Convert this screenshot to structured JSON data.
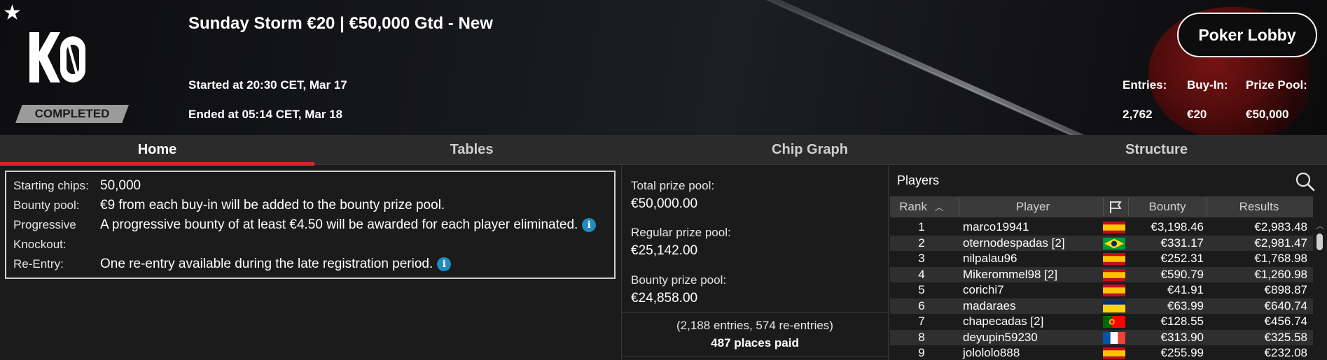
{
  "header": {
    "status_badge": "COMPLETED",
    "tournament_title": "Sunday Storm €20 | €50,000 Gtd - New",
    "started": "Started at 20:30 CET, Mar 17",
    "ended": "Ended at 05:14 CET, Mar 18",
    "lobby_button": "Poker Lobby",
    "logo_text": "KO",
    "stats": [
      {
        "label": "Entries:",
        "value": "2,762"
      },
      {
        "label": "Buy-In:",
        "value": "€20"
      },
      {
        "label": "Prize Pool:",
        "value": "€50,000"
      }
    ]
  },
  "tabs": [
    {
      "label": "Home",
      "active": true
    },
    {
      "label": "Tables",
      "active": false
    },
    {
      "label": "Chip Graph",
      "active": false
    },
    {
      "label": "Structure",
      "active": false
    }
  ],
  "info": {
    "starting_chips_label": "Starting chips:",
    "starting_chips_value": "50,000",
    "bounty_pool_label": "Bounty pool:",
    "bounty_pool_value": "€9 from each buy-in will be added to the bounty prize pool.",
    "progressive_label_1": "Progressive",
    "progressive_label_2": "Knockout:",
    "progressive_value": "A progressive bounty of at least €4.50 will be awarded for each player eliminated.",
    "reentry_label": "Re-Entry:",
    "reentry_value": "One re-entry available during the late registration period."
  },
  "prize": {
    "total_label": "Total prize pool:",
    "total_value": "€50,000.00",
    "regular_label": "Regular prize pool:",
    "regular_value": "€25,142.00",
    "bounty_label": "Bounty prize pool:",
    "bounty_value": "€24,858.00",
    "entries_note": "(2,188 entries, 574 re-entries)",
    "places_paid": "487 places paid"
  },
  "players": {
    "title": "Players",
    "columns": {
      "rank": "Rank",
      "player": "Player",
      "bounty": "Bounty",
      "results": "Results"
    },
    "rows": [
      {
        "rank": "1",
        "player": "marco19941",
        "flag": "es",
        "bounty": "€3,198.46",
        "result": "€2,983.48"
      },
      {
        "rank": "2",
        "player": "oternodespadas [2]",
        "flag": "br",
        "bounty": "€331.17",
        "result": "€2,981.47"
      },
      {
        "rank": "3",
        "player": "nilpalau96",
        "flag": "es",
        "bounty": "€252.31",
        "result": "€1,768.98"
      },
      {
        "rank": "4",
        "player": "Mikerommel98 [2]",
        "flag": "es",
        "bounty": "€590.79",
        "result": "€1,260.98"
      },
      {
        "rank": "5",
        "player": "corichi7",
        "flag": "es",
        "bounty": "€41.91",
        "result": "€898.87"
      },
      {
        "rank": "6",
        "player": "madaraes",
        "flag": "ro",
        "bounty": "€63.99",
        "result": "€640.74"
      },
      {
        "rank": "7",
        "player": "chapecadas [2]",
        "flag": "pt",
        "bounty": "€128.55",
        "result": "€456.74"
      },
      {
        "rank": "8",
        "player": "deyupin59230",
        "flag": "fr",
        "bounty": "€313.90",
        "result": "€325.58"
      },
      {
        "rank": "9",
        "player": "jolololo888",
        "flag": "es",
        "bounty": "€255.99",
        "result": "€232.08"
      }
    ]
  },
  "colors": {
    "accent_red": "#e0202a",
    "info_blue": "#1f8bbf"
  }
}
